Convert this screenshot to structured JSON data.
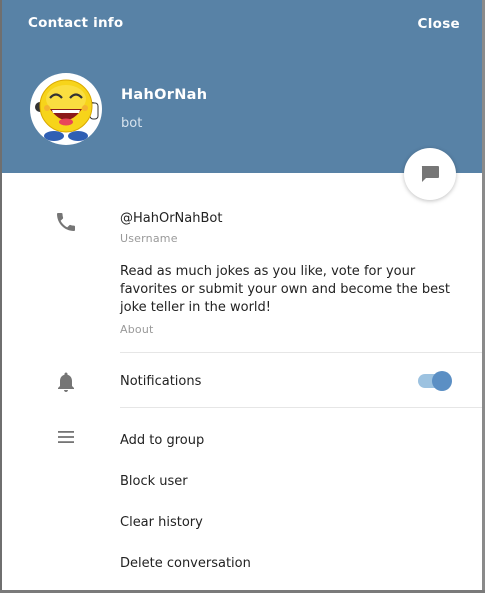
{
  "header": {
    "title": "Contact info",
    "close_label": "Close",
    "bg_color": "#5882a6"
  },
  "profile": {
    "name": "HahOrNah",
    "status": "bot",
    "avatar_icon": "smiley-face-avatar"
  },
  "fab": {
    "icon": "message-bubble-icon"
  },
  "info": {
    "username": "@HahOrNahBot",
    "username_caption": "Username",
    "about": "Read as much jokes as you like, vote for your favorites or submit your own and become the best joke teller in the world!",
    "about_caption": "About",
    "phone_icon": "phone-icon"
  },
  "notifications": {
    "label": "Notifications",
    "enabled": true,
    "icon": "bell-icon",
    "toggle_color": "#5b8fc4"
  },
  "actions": {
    "icon": "menu-icon",
    "items": [
      {
        "label": "Add to group"
      },
      {
        "label": "Block user"
      },
      {
        "label": "Clear history"
      },
      {
        "label": "Delete conversation"
      }
    ]
  }
}
